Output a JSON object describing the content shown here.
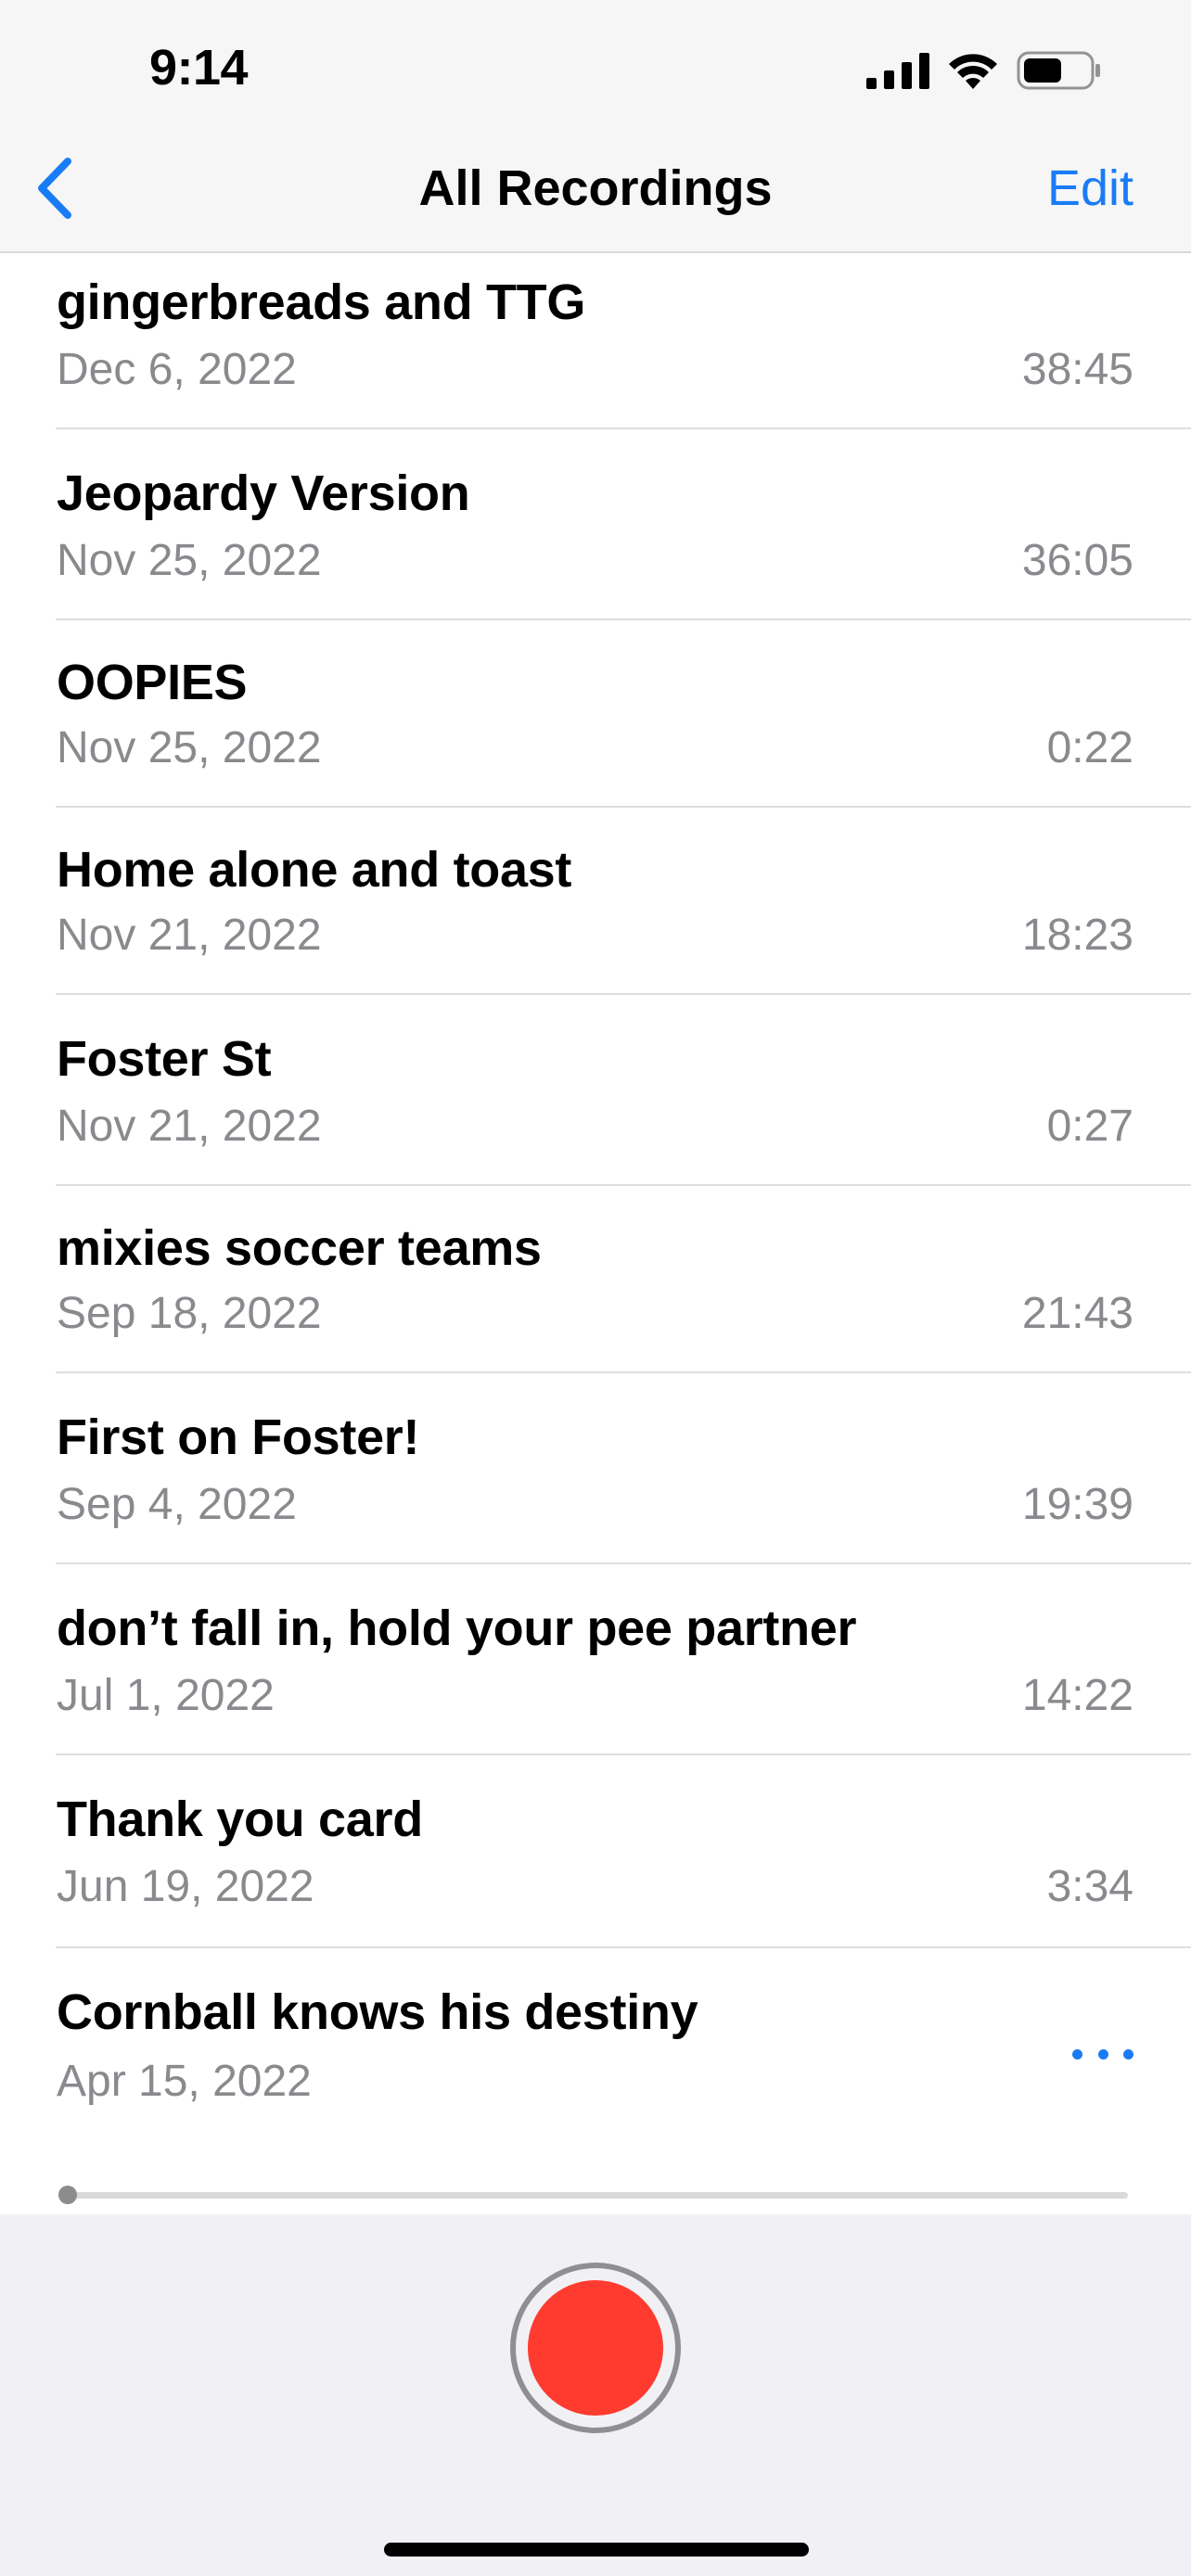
{
  "status_bar": {
    "time": "9:14",
    "icons": [
      "cellular-signal-icon",
      "wifi-icon",
      "battery-icon"
    ]
  },
  "nav": {
    "back_icon": "chevron-left-icon",
    "title": "All Recordings",
    "edit_label": "Edit"
  },
  "recordings": [
    {
      "title": "gingerbreads and TTG",
      "date": "Dec 6, 2022",
      "duration": "38:45"
    },
    {
      "title": "Jeopardy Version",
      "date": "Nov 25, 2022",
      "duration": "36:05"
    },
    {
      "title": "OOPIES",
      "date": "Nov 25, 2022",
      "duration": "0:22"
    },
    {
      "title": "Home alone and toast",
      "date": "Nov 21, 2022",
      "duration": "18:23"
    },
    {
      "title": "Foster St",
      "date": "Nov 21, 2022",
      "duration": "0:27"
    },
    {
      "title": "mixies soccer teams",
      "date": "Sep 18, 2022",
      "duration": "21:43"
    },
    {
      "title": "First on Foster!",
      "date": "Sep 4, 2022",
      "duration": "19:39"
    },
    {
      "title": "don’t fall in, hold your pee partner",
      "date": "Jul 1, 2022",
      "duration": "14:22"
    },
    {
      "title": "Thank you card",
      "date": "Jun 19, 2022",
      "duration": "3:34"
    },
    {
      "title": "Cornball knows his destiny",
      "date": "Apr 15, 2022",
      "duration": ""
    }
  ],
  "selected_recording": {
    "more_icon": "ellipsis-icon",
    "playback_progress": 0
  },
  "colors": {
    "accent": "#1a7cf5",
    "record": "#ff3b30",
    "secondary_text": "#8a8a8e"
  }
}
